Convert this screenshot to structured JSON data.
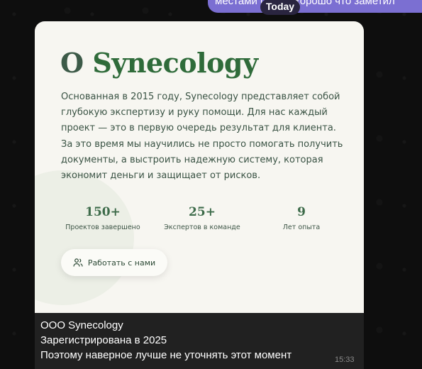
{
  "chat": {
    "previous_message": "местами (до..л) хорошо что заметил",
    "date_badge": "Today"
  },
  "preview": {
    "title_prefix": "О ",
    "title_brand": "Synecology",
    "about": "Основанная в 2015 году, Synecology представляет собой глубокую экспертизу и руку помощи. Для нас каждый проект — это в первую очередь результат для клиента. За это время мы научились не просто помогать получить документы, а выстроить надежную систему, которая экономит деньги и защищает от рисков.",
    "stats": [
      {
        "value": "150+",
        "label": "Проектов завершено"
      },
      {
        "value": "25+",
        "label": "Экспертов в команде"
      },
      {
        "value": "9",
        "label": "Лет опыта"
      }
    ],
    "cta_label": "Работать с нами",
    "cta_icon": "users-icon"
  },
  "caption": {
    "line1": "ООО Synecology",
    "line2": "Зарегистрирована в 2025",
    "line3": "Поэтому наверное лучше не уточнять этот момент",
    "time": "15:33"
  },
  "colors": {
    "chat_background": "#0e0e0e",
    "bubble_accent": "#7b6fd2",
    "preview_background": "#f7f6f1",
    "brand_green": "#2f6b3a",
    "caption_background": "#212121"
  }
}
